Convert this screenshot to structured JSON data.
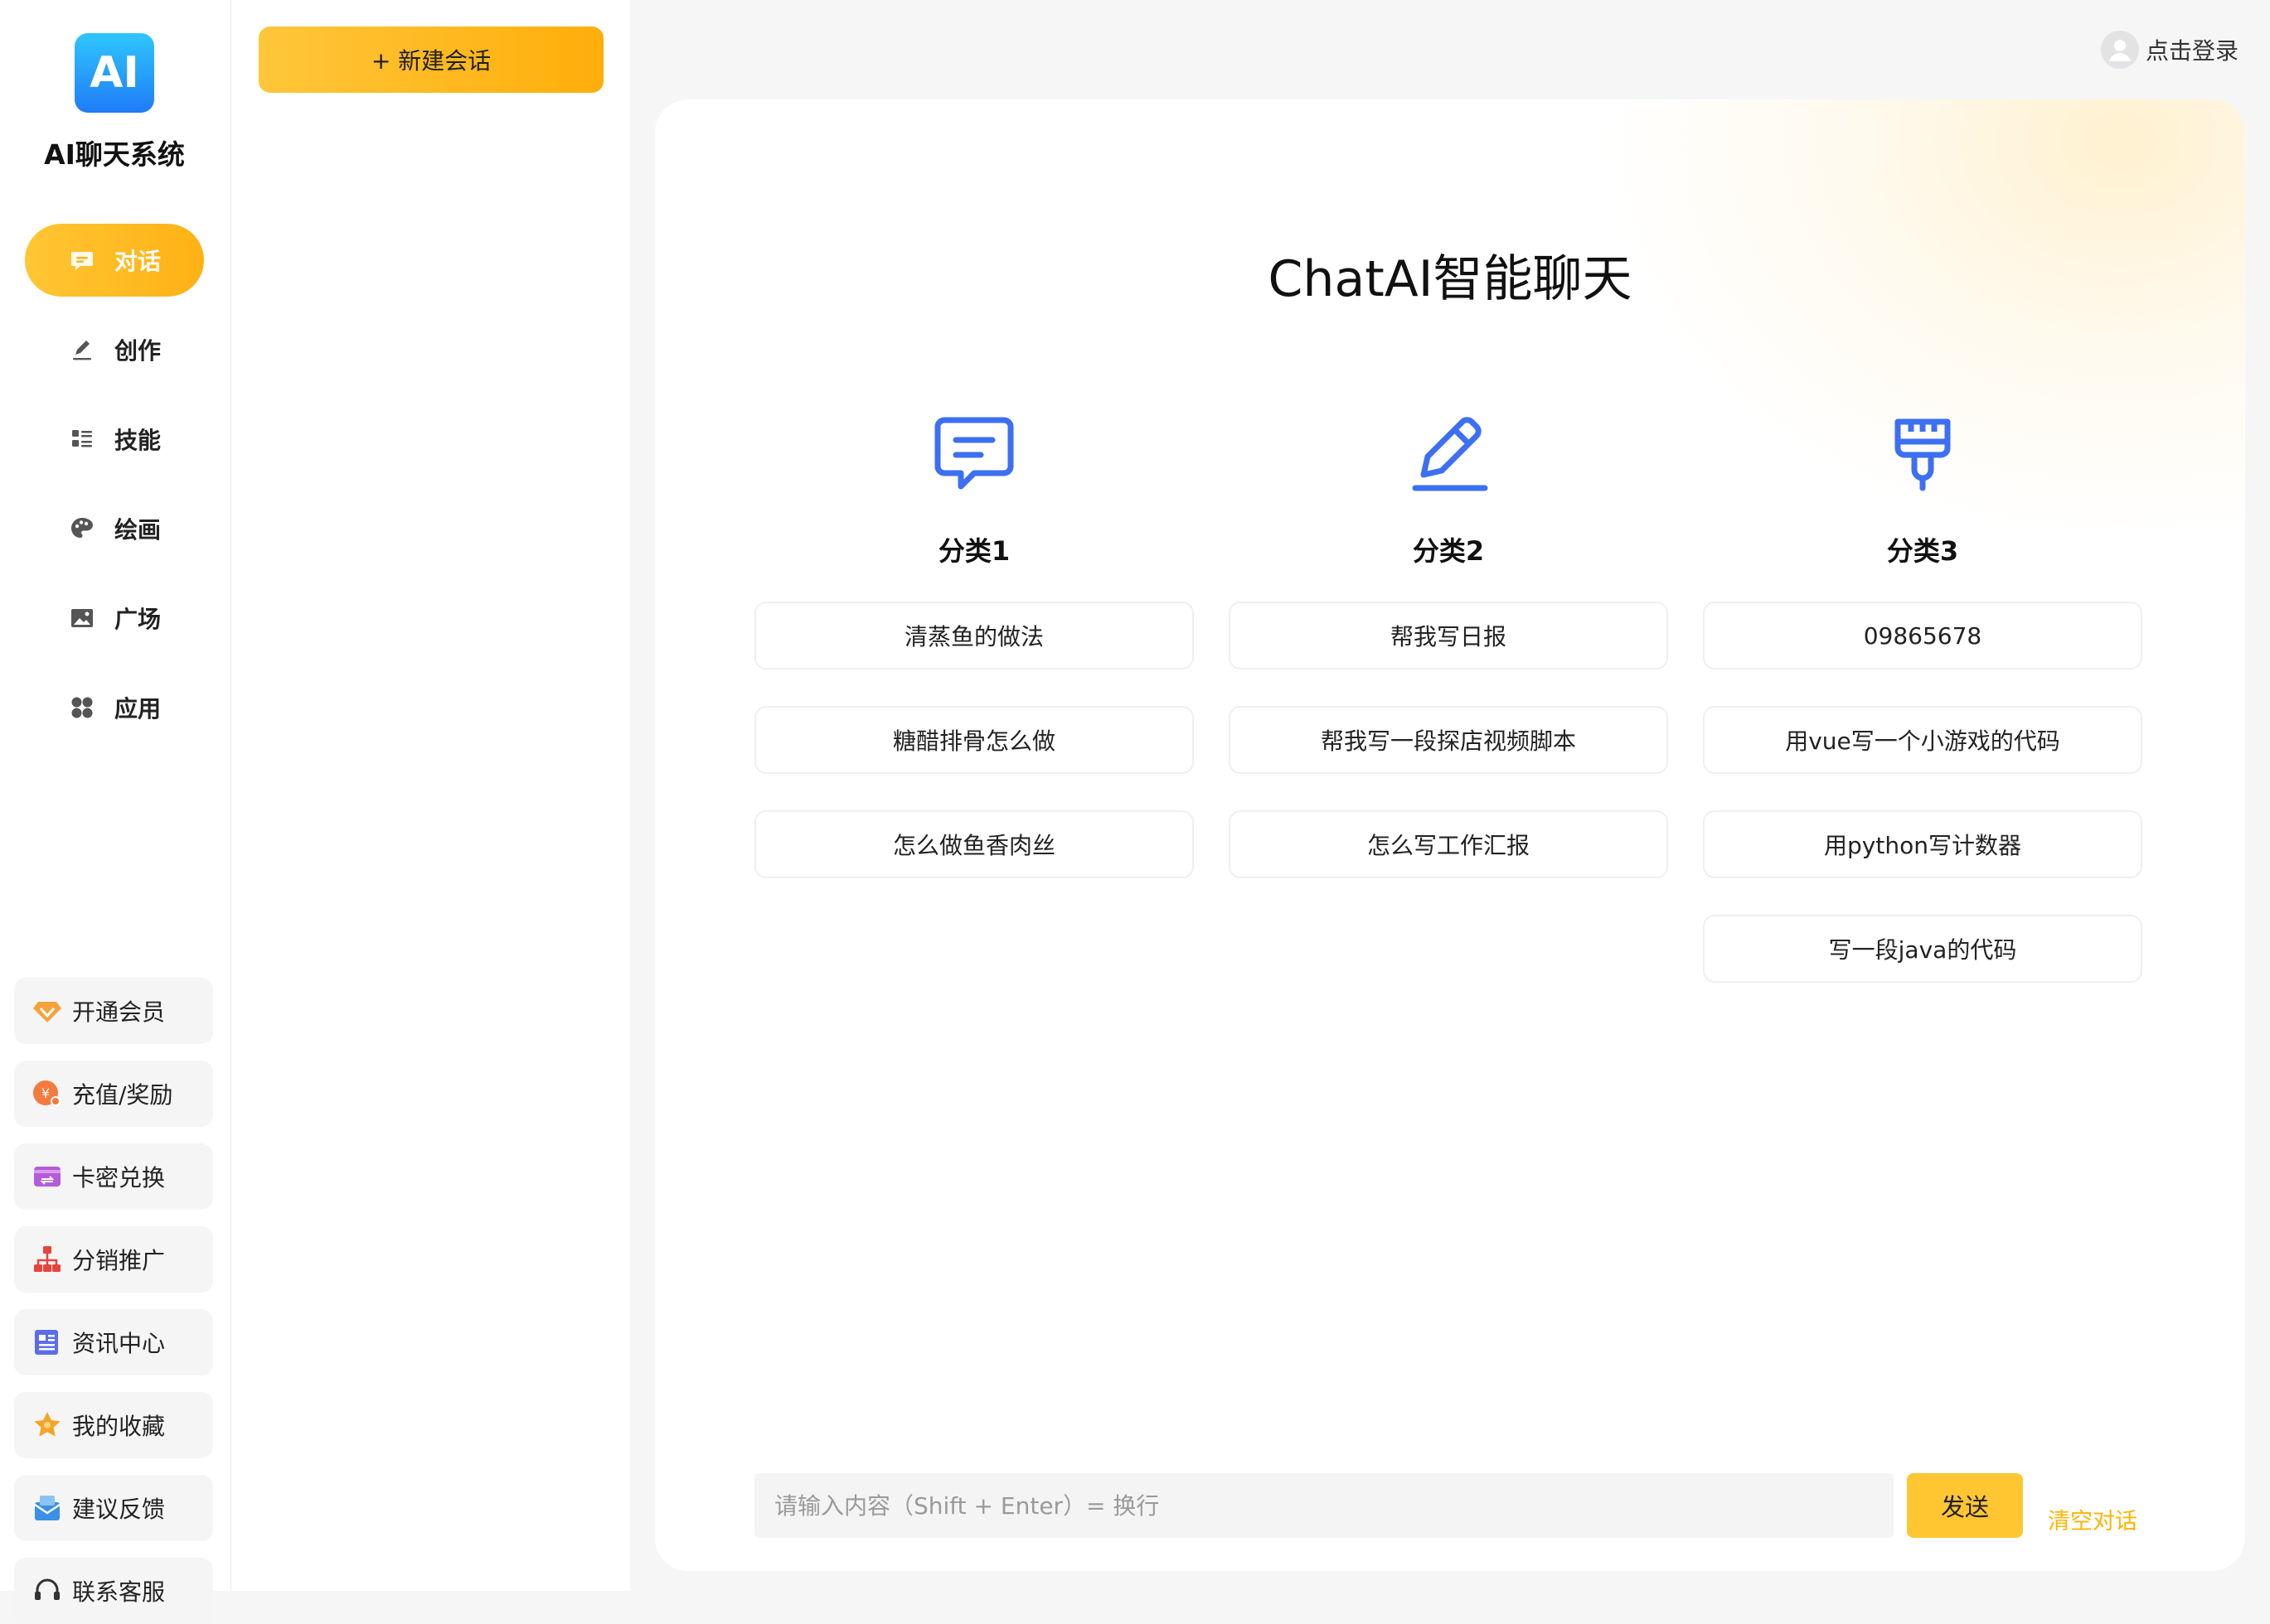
{
  "brand": {
    "logo_text": "AI",
    "title": "AI聊天系统"
  },
  "nav": [
    {
      "label": "对话",
      "icon": "chat-bubble-icon",
      "active": true
    },
    {
      "label": "创作",
      "icon": "pen-icon",
      "active": false
    },
    {
      "label": "技能",
      "icon": "list-grid-icon",
      "active": false
    },
    {
      "label": "绘画",
      "icon": "palette-icon",
      "active": false
    },
    {
      "label": "广场",
      "icon": "picture-icon",
      "active": false
    },
    {
      "label": "应用",
      "icon": "apps-icon",
      "active": false
    }
  ],
  "side_cards": [
    {
      "label": "开通会员",
      "icon": "diamond-icon"
    },
    {
      "label": "充值/奖励",
      "icon": "coin-icon"
    },
    {
      "label": "卡密兑换",
      "icon": "card-exchange-icon"
    },
    {
      "label": "分销推广",
      "icon": "org-chart-icon"
    },
    {
      "label": "资讯中心",
      "icon": "news-icon"
    },
    {
      "label": "我的收藏",
      "icon": "star-icon"
    },
    {
      "label": "建议反馈",
      "icon": "mail-icon"
    },
    {
      "label": "联系客服",
      "icon": "headset-icon"
    }
  ],
  "conversation": {
    "new_chat_label": "+ 新建会话"
  },
  "header": {
    "login_label": "点击登录"
  },
  "main": {
    "title": "ChatAI智能聊天",
    "categories": [
      {
        "title": "分类1",
        "icon": "message-icon",
        "prompts": [
          "清蒸鱼的做法",
          "糖醋排骨怎么做",
          "怎么做鱼香肉丝"
        ]
      },
      {
        "title": "分类2",
        "icon": "edit-icon",
        "prompts": [
          "帮我写日报",
          "帮我写一段探店视频脚本",
          "怎么写工作汇报"
        ]
      },
      {
        "title": "分类3",
        "icon": "brush-icon",
        "prompts": [
          "09865678",
          "用vue写一个小游戏的代码",
          "用python写计数器",
          "写一段java的代码"
        ]
      }
    ],
    "input_placeholder": "请输入内容（Shift + Enter）= 换行",
    "send_label": "发送",
    "clear_label": "清空对话"
  },
  "colors": {
    "accent": "#ffb114",
    "icon_blue": "#3d6ff2",
    "logo_blue": "#1f7cf6"
  }
}
